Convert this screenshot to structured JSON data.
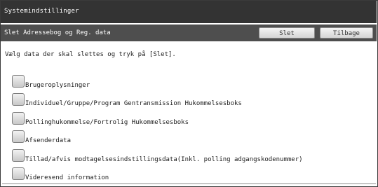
{
  "header": {
    "title": "Systemindstillinger"
  },
  "subheader": {
    "title": "Slet Adressebog og Reg. data",
    "delete_label": "Slet",
    "back_label": "Tilbage"
  },
  "instruction": "Vælg data der skal slettes og tryk på [Slet].",
  "items": [
    {
      "label": "Brugeroplysninger",
      "checked": false
    },
    {
      "label": "Individuel/Gruppe/Program Gentransmission Hukommelsesboks",
      "checked": false
    },
    {
      "label": "Pollinghukommelse/Fortrolig Hukommelsesboks",
      "checked": false
    },
    {
      "label": "Afsenderdata",
      "checked": false
    },
    {
      "label": "Tillad/afvis modtagelsesindstillingsdata(Inkl. polling adgangskodenummer)",
      "checked": false
    },
    {
      "label": "Videresend information",
      "checked": false
    }
  ]
}
